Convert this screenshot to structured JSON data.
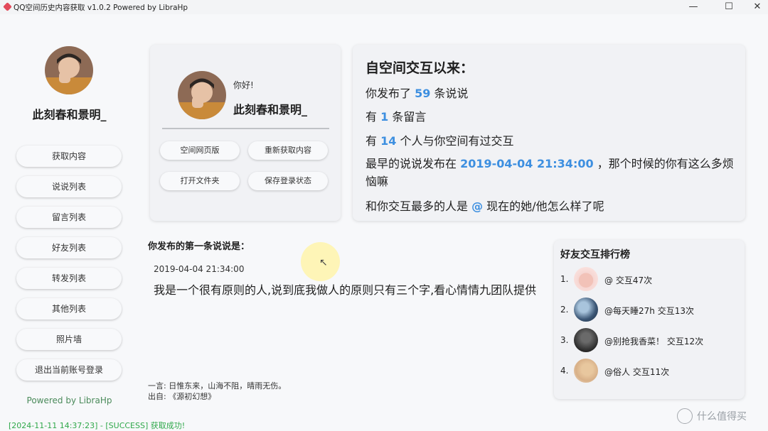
{
  "titlebar": {
    "title": "QQ空间历史内容获取 v1.0.2 Powered by LibraHp",
    "min": "—",
    "max": "☐",
    "close": "✕"
  },
  "sidebar": {
    "username": "此刻春和景明_",
    "menu": [
      "获取内容",
      "说说列表",
      "留言列表",
      "好友列表",
      "转发列表",
      "其他列表",
      "照片墙",
      "退出当前账号登录"
    ],
    "powered_by": "Powered by LibraHp"
  },
  "profile": {
    "greeting": "你好!",
    "username": "此刻春和景明_",
    "buttons": [
      "空间网页版",
      "重新获取内容",
      "打开文件夹",
      "保存登录状态"
    ]
  },
  "stats": {
    "title": "自空间交互以来：",
    "line1": {
      "pre": "你发布了 ",
      "value": "59",
      "post": " 条说说"
    },
    "line2": {
      "pre": "有 ",
      "value": "1",
      "post": " 条留言"
    },
    "line3": {
      "pre": "有 ",
      "value": "14",
      "post": " 个人与你空间有过交互"
    },
    "line4": {
      "pre": "最早的说说发布在 ",
      "value": "2019-04-04 21:34:00",
      "post": " ，那个时候的你有这么多烦恼嘛"
    },
    "line5": {
      "pre": "和你交互最多的人是 ",
      "value": "@",
      "post": "  现在的她/他怎么样了呢"
    }
  },
  "first_post": {
    "label": "你发布的第一条说说是：",
    "date": "2019-04-04 21:34:00",
    "content": "我是一个很有原则的人,说到底我做人的原则只有三个字,看心情情九团队提供"
  },
  "quote": {
    "text": "一言: 日惟东来，山海不阻，晴雨无伤。",
    "source": "出自: 《源初幻想》"
  },
  "status_bar": "[2024-11-11 14:37:23] - [SUCCESS] 获取成功!",
  "ranking": {
    "title": "好友交互排行榜",
    "items": [
      {
        "rank": "1.",
        "text": "@  交互47次"
      },
      {
        "rank": "2.",
        "text": "@每天睡27h 交互13次"
      },
      {
        "rank": "3.",
        "text": "@别抢我香菜！ 交互12次"
      },
      {
        "rank": "4.",
        "text": "@俗人 交互11次"
      }
    ]
  },
  "watermark": "什么值得买",
  "colors": {
    "accent": "#3d8fe0",
    "success": "#2fa84a",
    "powered": "#4a8a5a"
  },
  "icons": [
    "app-logo-icon",
    "minimize-icon",
    "maximize-icon",
    "close-icon",
    "cursor-icon",
    "watermark-logo-icon"
  ]
}
